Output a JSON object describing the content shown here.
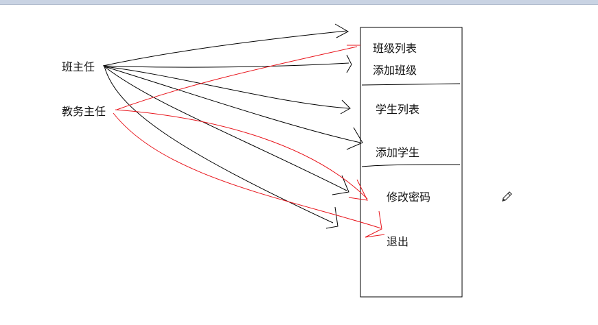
{
  "roles": {
    "head_teacher": "班主任",
    "academic_director": "教务主任"
  },
  "menu": {
    "class_list": "班级列表",
    "add_class": "添加班级",
    "student_list": "学生列表",
    "add_student": "添加学生",
    "change_password": "修改密码",
    "logout": "退出"
  },
  "colors": {
    "head_teacher_arrows": "#000000",
    "academic_director_arrows": "#e8141b",
    "box_border": "#000000",
    "top_bar": "#c9d3e3"
  },
  "icons": {
    "cursor": "pencil-icon"
  }
}
